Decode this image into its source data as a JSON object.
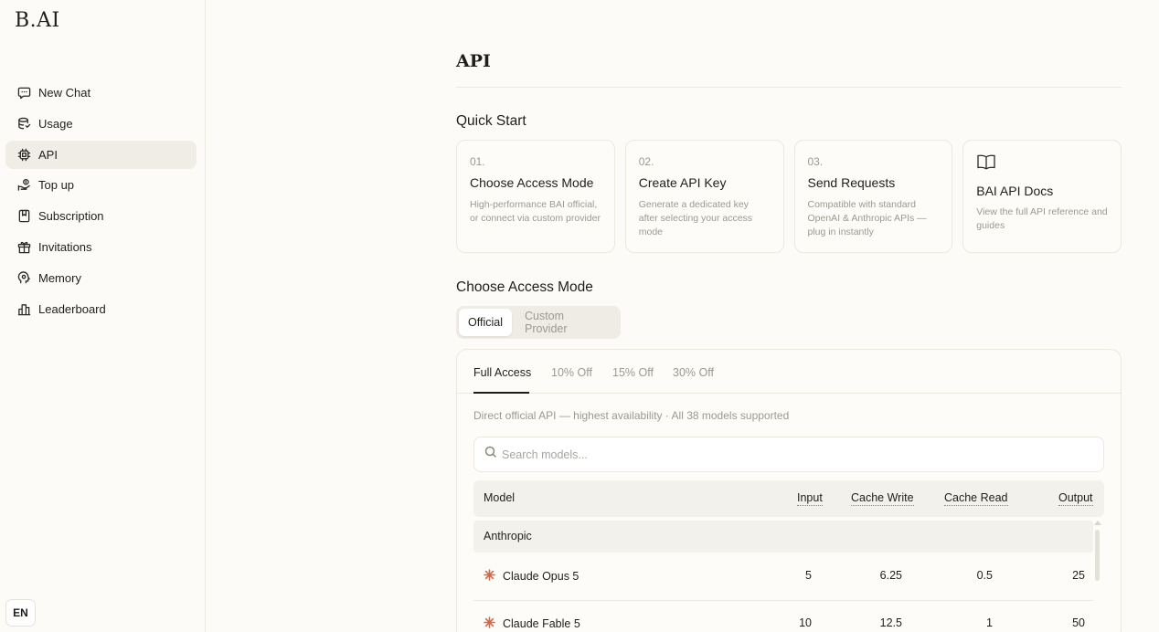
{
  "app": {
    "logo": "B.AI"
  },
  "sidebar": {
    "items": [
      {
        "label": "New Chat",
        "icon": "chat-bubble-icon"
      },
      {
        "label": "Usage",
        "icon": "database-icon"
      },
      {
        "label": "API",
        "icon": "chip-icon",
        "active": true
      },
      {
        "label": "Top up",
        "icon": "hand-coin-icon"
      },
      {
        "label": "Subscription",
        "icon": "bookmark-icon"
      },
      {
        "label": "Invitations",
        "icon": "gift-icon"
      },
      {
        "label": "Memory",
        "icon": "brain-icon"
      },
      {
        "label": "Leaderboard",
        "icon": "leaderboard-icon"
      }
    ],
    "language": "EN"
  },
  "page": {
    "title": "API"
  },
  "quick_start": {
    "title": "Quick Start",
    "cards": [
      {
        "num": "01.",
        "title": "Choose Access Mode",
        "desc": "High-performance BAI official, or connect via custom provider"
      },
      {
        "num": "02.",
        "title": "Create API Key",
        "desc": "Generate a dedicated key after selecting your access mode"
      },
      {
        "num": "03.",
        "title": "Send Requests",
        "desc": "Compatible with standard OpenAI & Anthropic APIs — plug in instantly"
      },
      {
        "title": "BAI API Docs",
        "desc": "View the full API reference and guides",
        "icon": "book-icon"
      }
    ]
  },
  "access_mode": {
    "title": "Choose Access Mode",
    "segments": [
      "Official",
      "Custom Provider"
    ],
    "selected_segment": "Official",
    "tabs": [
      "Full Access",
      "10% Off",
      "15% Off",
      "30% Off"
    ],
    "selected_tab": "Full Access",
    "description": "Direct official API — highest availability · All 38 models supported",
    "search_placeholder": "Search models...",
    "table": {
      "headers": [
        "Model",
        "Input",
        "Cache Write",
        "Cache Read",
        "Output"
      ],
      "group": "Anthropic",
      "rows": [
        {
          "model": "Claude Opus 5",
          "input": "5",
          "cache_write": "6.25",
          "cache_read": "0.5",
          "output": "25"
        },
        {
          "model": "Claude Fable 5",
          "input": "10",
          "cache_write": "12.5",
          "cache_read": "1",
          "output": "50"
        }
      ]
    }
  },
  "colors": {
    "background": "#fcfbf7",
    "anthropic_accent": "#d9663e",
    "muted_text": "#9c998f"
  }
}
